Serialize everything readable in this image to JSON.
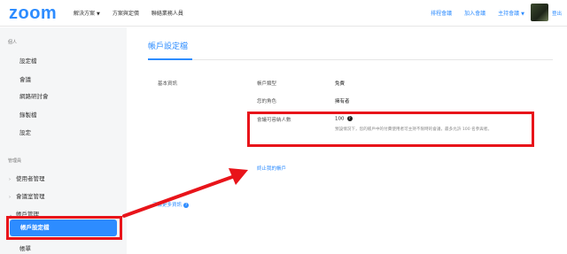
{
  "header": {
    "logo": "zoom",
    "nav_left": [
      "解決方案",
      "方案與定價",
      "聯絡業務人員"
    ],
    "nav_right": [
      "排程會議",
      "加入會議",
      "主持會議"
    ],
    "logout": "登出"
  },
  "sidebar": {
    "personal_section": "個人",
    "personal_items": [
      "設定檔",
      "會議",
      "網路研討會",
      "錄製檔",
      "設定"
    ],
    "admin_section": "管理員",
    "admin_items": [
      "使用者管理",
      "會議室管理",
      "帳戶管理"
    ],
    "active_item": "帳戶設定檔",
    "next_item": "帳單"
  },
  "main": {
    "page_title": "帳戶設定檔",
    "section_label": "基本資訊",
    "rows": [
      {
        "label": "帳戶類型",
        "value": "免費"
      },
      {
        "label": "您的角色",
        "value": "擁有者"
      },
      {
        "label": "會議可容納人數",
        "value": "100"
      }
    ],
    "capacity_note": "預設情況下，您的帳戶中的付費使用者可主持不限時的會議，最多允許 100 名參與者。",
    "terminate_link": "終止我的帳戶",
    "info_link": "了解更多資訊"
  },
  "colors": {
    "accent": "#2d8cff",
    "highlight": "#e8141a",
    "sidebar_bg": "#f5f6f7"
  }
}
